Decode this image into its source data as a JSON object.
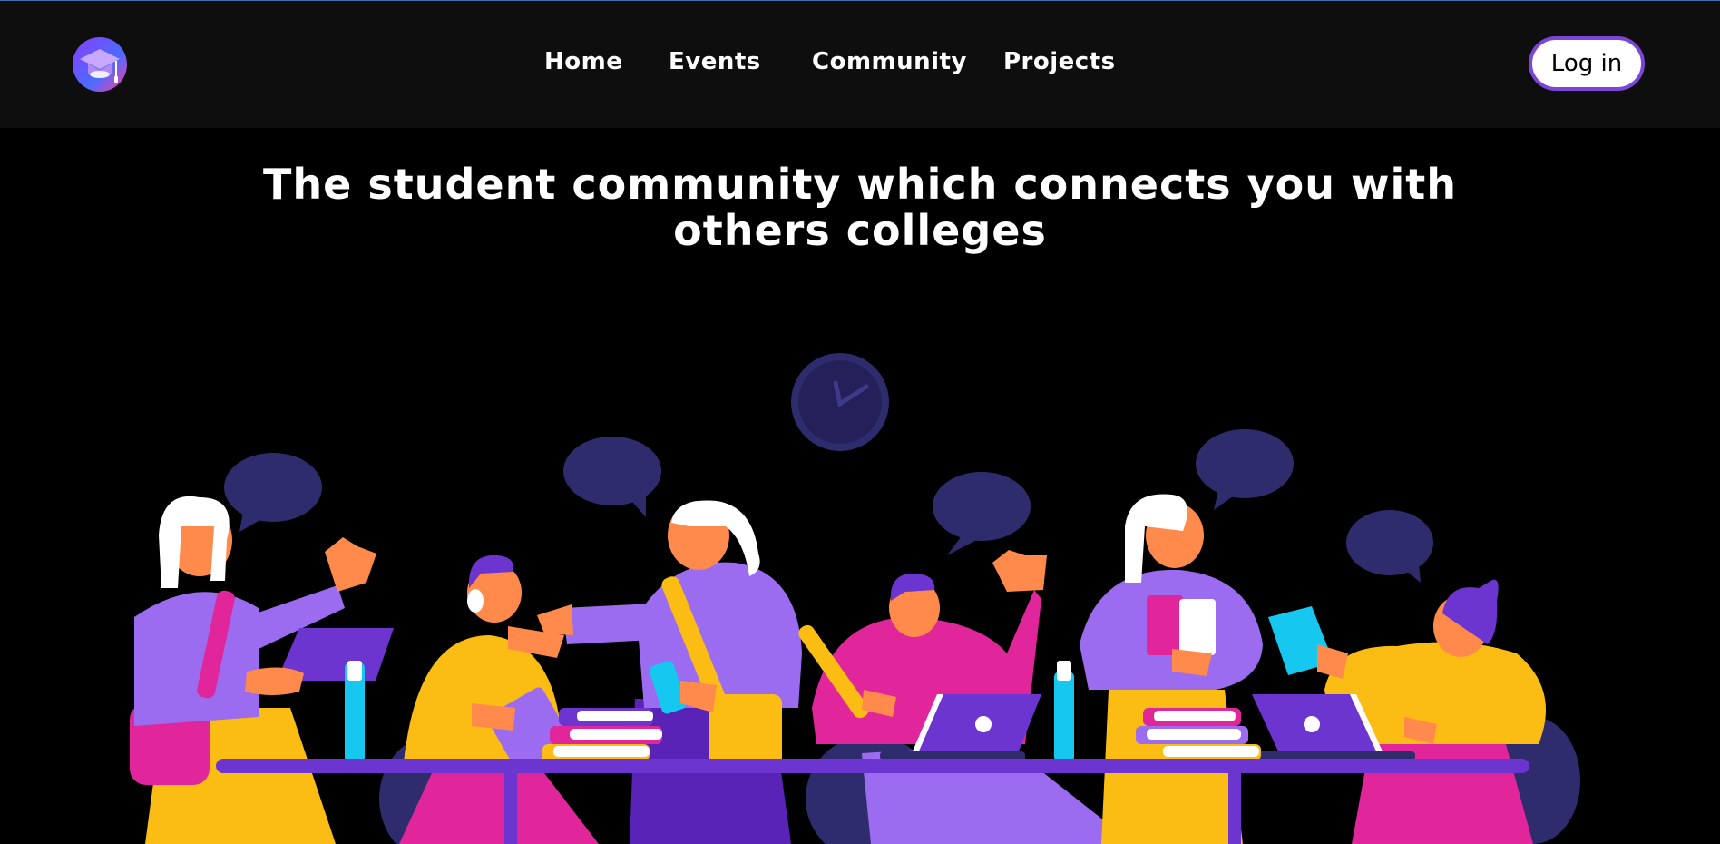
{
  "nav": {
    "logo_icon": "graduation-cap-icon",
    "links": [
      {
        "label": "Home"
      },
      {
        "label": "Events"
      },
      {
        "label": "Community"
      },
      {
        "label": "Projects"
      }
    ],
    "login_label": "Log in"
  },
  "hero": {
    "headline": "The student community which connects you with others colleges",
    "illustration": "students-collaborating-illustration"
  },
  "colors": {
    "page_bg": "#000000",
    "nav_bg": "#0e0e0e",
    "accent_purple": "#7b45d8",
    "illustration_purple": "#9b6cf0",
    "illustration_yellow": "#fbbc14",
    "illustration_pink": "#e0269a",
    "illustration_cyan": "#16c7f0",
    "bubble_navy": "#2f2c6e"
  }
}
